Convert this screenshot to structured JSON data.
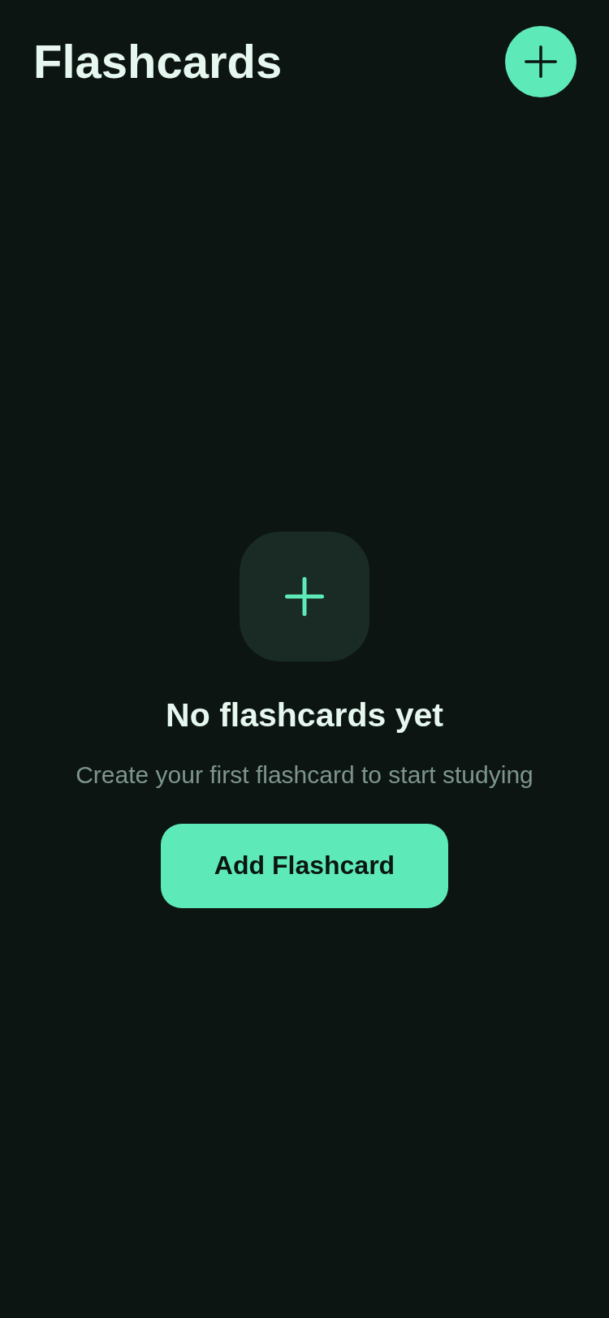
{
  "header": {
    "title": "Flashcards"
  },
  "empty_state": {
    "title": "No flashcards yet",
    "message": "Create your first flashcard to start studying",
    "button": "Add Flashcard"
  }
}
